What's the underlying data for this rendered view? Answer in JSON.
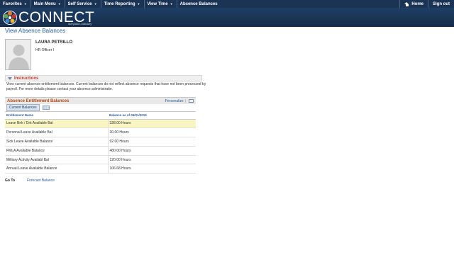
{
  "nav": {
    "items": [
      {
        "label": "Favorites"
      },
      {
        "label": "Main Menu"
      },
      {
        "label": "Self Service"
      },
      {
        "label": "Time Reporting"
      },
      {
        "label": "View Time"
      },
      {
        "label": "Absence Balances"
      }
    ],
    "home_label": "Home",
    "signout_label": "Sign out"
  },
  "banner": {
    "logo_text": "CONNECT",
    "logo_sub": "Maryland Judiciary"
  },
  "page": {
    "title": "View Absence Balances"
  },
  "employee": {
    "name": "LAURA PETRILLO",
    "job_title": "HR Officer I"
  },
  "instructions": {
    "label": "Instructions",
    "text": "View current absence entitlement balances. Current balances do not reflect absence requests that have not been processed by payroll. For more details please contact your absence administrator."
  },
  "grid": {
    "title": "Absence Entitlement Balances",
    "personalize_label": "Personalize",
    "tab_label": "Current Balances",
    "columns": [
      "Entitlement Name",
      "Balance as of 05/01/2015"
    ],
    "rows": [
      {
        "name": "Leave Bnk / Dnt Available Bal",
        "balance": "328.00 Hours"
      },
      {
        "name": "Personal Leave Available Bal",
        "balance": "30.00 Hours"
      },
      {
        "name": "Sick Leave Available Balance",
        "balance": "92.00 Hours"
      },
      {
        "name": "FMLA Available Balance",
        "balance": "480.00 Hours"
      },
      {
        "name": "Military Activity Availabl Bal",
        "balance": "120.00 Hours"
      },
      {
        "name": "Annual Leave Available Balance",
        "balance": "106.68 Hours"
      }
    ]
  },
  "footer": {
    "goto_label": "Go To",
    "forecast_label": "Forecast Balance"
  },
  "colors": {
    "nav_bg": "#1b3455",
    "link": "#2b5d9c",
    "section_title": "#b24a1a",
    "selected_row": "#faf6c4"
  }
}
